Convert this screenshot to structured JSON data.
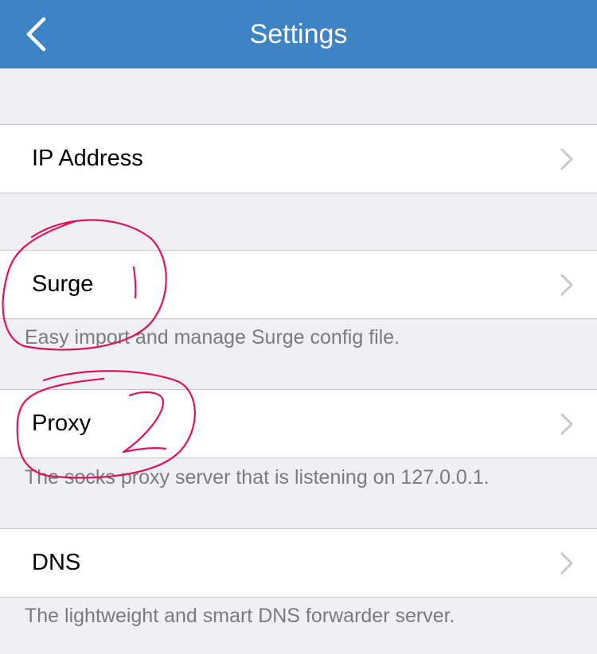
{
  "navbar": {
    "title": "Settings",
    "back_icon": "chevron-left-icon",
    "background_color": "#3d84c6"
  },
  "rows": [
    {
      "label": "IP Address"
    },
    {
      "label": "Surge",
      "footer": "Easy import and manage Surge config file."
    },
    {
      "label": "Proxy",
      "footer": "The socks proxy server that is listening on 127.0.0.1."
    },
    {
      "label": "DNS",
      "footer": "The lightweight and smart DNS forwarder server."
    }
  ],
  "annotations": {
    "color": "#e0115f",
    "marks": [
      "1",
      "2"
    ]
  }
}
